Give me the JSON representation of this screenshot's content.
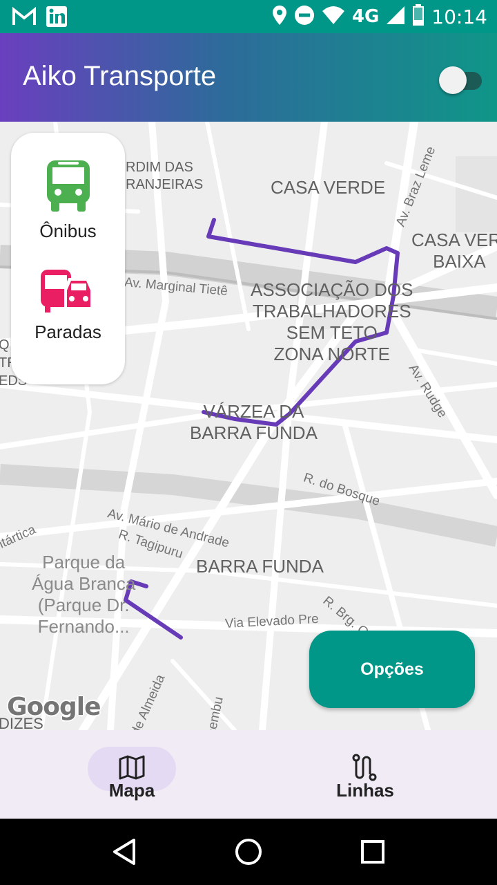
{
  "status_bar": {
    "time": "10:14",
    "network": "4G",
    "left_icons": [
      "gmail-icon",
      "linkedin-icon"
    ],
    "right_icons": [
      "location-icon",
      "do-not-disturb-icon",
      "wifi-icon",
      "signal-icon",
      "battery-icon"
    ]
  },
  "app_bar": {
    "title": "Aiko Transporte",
    "toggle_on": false
  },
  "side_panel": {
    "buses_label": "Ônibus",
    "stops_label": "Paradas",
    "bus_color": "#4caf50",
    "stop_color": "#e91e63"
  },
  "map": {
    "labels": {
      "jardim_l1": "RDIM DAS",
      "jardim_l2": "RANJEIRAS",
      "casa_verde": "CASA VERDE",
      "casa_verde_baixa_l1": "CASA VERD",
      "casa_verde_baixa_l2": "BAIXA",
      "assoc_l1": "ASSOCIAÇÃO DOS",
      "assoc_l2": "TRABALHADORES",
      "assoc_l3": "SEM TETO",
      "assoc_l4": "ZONA NORTE",
      "varzea_l1": "VÁRZEA DA",
      "varzea_l2": "BARRA FUNDA",
      "barra_funda": "BARRA FUNDA",
      "parque_l1": "Parque da",
      "parque_l2": "Água Branca",
      "parque_l3": "(Parque Dr.",
      "parque_l4": "Fernando...",
      "edge_q": "Q",
      "edge_tr": "TR",
      "edge_eds": "EDS",
      "edge_dizes": "DIZES"
    },
    "streets": {
      "marginal": "Av. Marginal Tietê",
      "braz_leme": "Av. Braz Leme",
      "rudge": "Av. Rudge",
      "bosque": "R. do Bosque",
      "mario_andrade": "Av. Mário de Andrade",
      "tagipuru": "R. Tagipuru",
      "antartica": "ntártica",
      "brg_g": "R. Brg. G",
      "via_elevado": "Via Elevado Pre",
      "almeida": "de Almeida",
      "aembu": "aembu"
    },
    "attribution": "Google",
    "route_color": "#673ab7"
  },
  "options_button": {
    "label": "Opções"
  },
  "bottom_nav": {
    "items": [
      {
        "label": "Mapa",
        "icon": "map-icon",
        "selected": true
      },
      {
        "label": "Linhas",
        "icon": "route-icon",
        "selected": false
      }
    ]
  },
  "system_nav": [
    "back-icon",
    "home-icon",
    "recents-icon"
  ]
}
